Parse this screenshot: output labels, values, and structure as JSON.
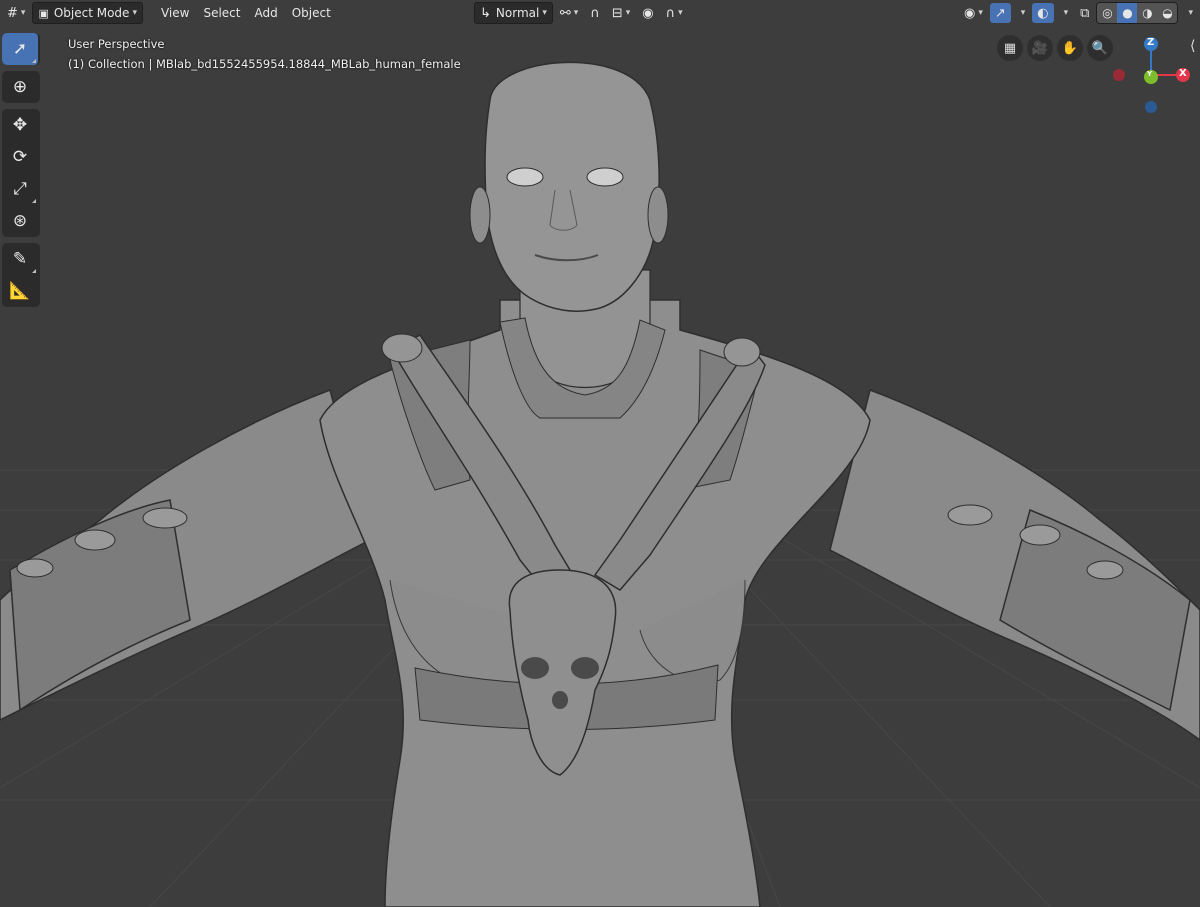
{
  "header": {
    "editor_icon": "grid-hash-icon",
    "mode_label": "Object Mode",
    "menus": [
      "View",
      "Select",
      "Add",
      "Object"
    ],
    "orientation_label": "Normal"
  },
  "viewport": {
    "perspective_label": "User Perspective",
    "collection_label": "(1) Collection | MBlab_bd1552455954.18844_MBLab_human_female"
  },
  "navigation_gizmo": {
    "x_label": "X",
    "y_label": "Y",
    "z_label": "Z",
    "x_color": "#e2374a",
    "y_color": "#7dbd2c",
    "z_color": "#3479c8"
  },
  "toolbar": {
    "tools": [
      "select-box",
      "cursor",
      "move",
      "rotate",
      "scale",
      "transform",
      "annotate",
      "measure"
    ],
    "active_tool": "select-box"
  },
  "colors": {
    "accent": "#4772b3",
    "viewport_bg": "#3d3d3d",
    "header_bg": "#2b2b2b"
  }
}
